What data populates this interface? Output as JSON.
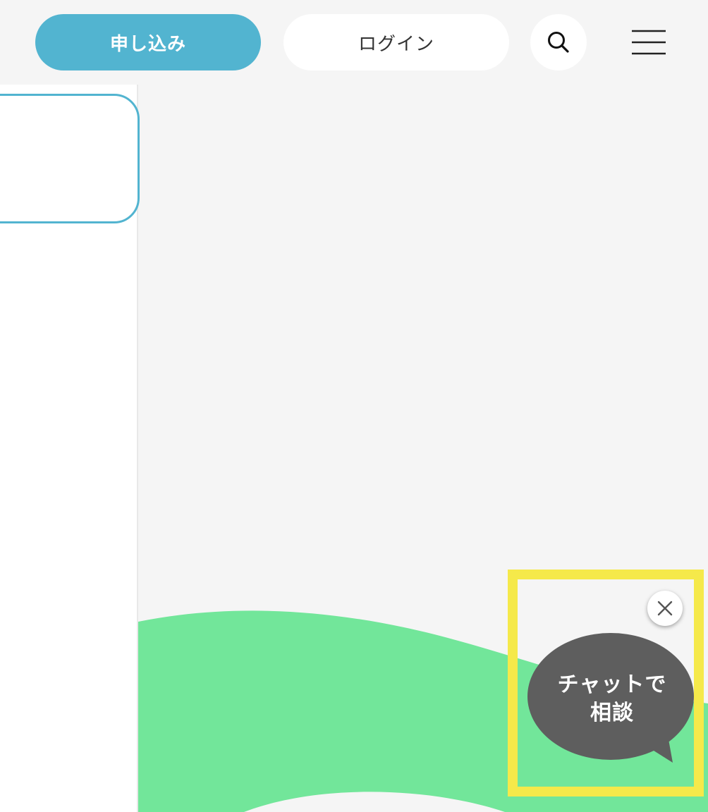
{
  "header": {
    "apply_label": "申し込み",
    "login_label": "ログイン",
    "search_icon": "search-icon",
    "menu_icon": "hamburger-menu-icon"
  },
  "chat_widget": {
    "line1": "チャットで",
    "line2": "相談",
    "close_icon": "close-icon"
  },
  "colors": {
    "accent": "#52b4d0",
    "background": "#f5f5f5",
    "wave": "#72e69a",
    "chat_bubble": "#5e5e5e",
    "highlight": "#f5e94a"
  }
}
